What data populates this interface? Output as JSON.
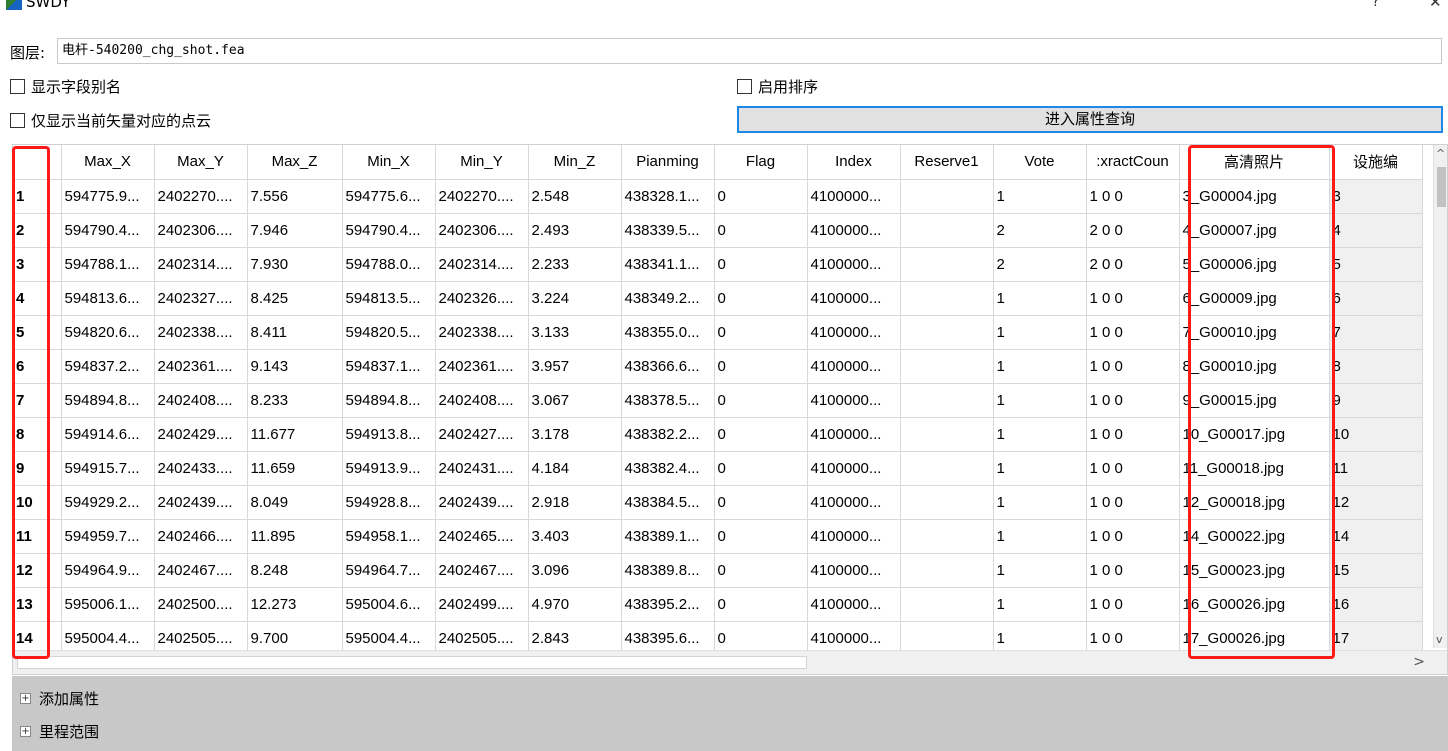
{
  "window": {
    "title": "SWDY",
    "help": "?",
    "close": "✕"
  },
  "layer": {
    "label": "图层:",
    "value": "电杆-540200_chg_shot.fea"
  },
  "options": {
    "show_alias": "显示字段别名",
    "enable_sort": "启用排序",
    "only_current_vector": "仅显示当前矢量对应的点云",
    "query_button": "进入属性查询"
  },
  "table": {
    "columns": [
      "",
      "Max_X",
      "Max_Y",
      "Max_Z",
      "Min_X",
      "Min_Y",
      "Min_Z",
      "Pianming",
      "Flag",
      "Index",
      "Reserve1",
      "Vote",
      ":xractCoun",
      "高清照片",
      "设施编"
    ],
    "rows": [
      [
        "1",
        "594775.9...",
        "2402270....",
        "7.556",
        "594775.6...",
        "2402270....",
        "2.548",
        "438328.1...",
        "0",
        "4100000...",
        "",
        "1",
        "1 0 0",
        "3_G00004.jpg",
        "3"
      ],
      [
        "2",
        "594790.4...",
        "2402306....",
        "7.946",
        "594790.4...",
        "2402306....",
        "2.493",
        "438339.5...",
        "0",
        "4100000...",
        "",
        "2",
        "2 0 0",
        "4_G00007.jpg",
        "4"
      ],
      [
        "3",
        "594788.1...",
        "2402314....",
        "7.930",
        "594788.0...",
        "2402314....",
        "2.233",
        "438341.1...",
        "0",
        "4100000...",
        "",
        "2",
        "2 0 0",
        "5_G00006.jpg",
        "5"
      ],
      [
        "4",
        "594813.6...",
        "2402327....",
        "8.425",
        "594813.5...",
        "2402326....",
        "3.224",
        "438349.2...",
        "0",
        "4100000...",
        "",
        "1",
        "1 0 0",
        "6_G00009.jpg",
        "6"
      ],
      [
        "5",
        "594820.6...",
        "2402338....",
        "8.411",
        "594820.5...",
        "2402338....",
        "3.133",
        "438355.0...",
        "0",
        "4100000...",
        "",
        "1",
        "1 0 0",
        "7_G00010.jpg",
        "7"
      ],
      [
        "6",
        "594837.2...",
        "2402361....",
        "9.143",
        "594837.1...",
        "2402361....",
        "3.957",
        "438366.6...",
        "0",
        "4100000...",
        "",
        "1",
        "1 0 0",
        "8_G00010.jpg",
        "8"
      ],
      [
        "7",
        "594894.8...",
        "2402408....",
        "8.233",
        "594894.8...",
        "2402408....",
        "3.067",
        "438378.5...",
        "0",
        "4100000...",
        "",
        "1",
        "1 0 0",
        "9_G00015.jpg",
        "9"
      ],
      [
        "8",
        "594914.6...",
        "2402429....",
        "11.677",
        "594913.8...",
        "2402427....",
        "3.178",
        "438382.2...",
        "0",
        "4100000...",
        "",
        "1",
        "1 0 0",
        "10_G00017.jpg",
        "10"
      ],
      [
        "9",
        "594915.7...",
        "2402433....",
        "11.659",
        "594913.9...",
        "2402431....",
        "4.184",
        "438382.4...",
        "0",
        "4100000...",
        "",
        "1",
        "1 0 0",
        "11_G00018.jpg",
        "11"
      ],
      [
        "10",
        "594929.2...",
        "2402439....",
        "8.049",
        "594928.8...",
        "2402439....",
        "2.918",
        "438384.5...",
        "0",
        "4100000...",
        "",
        "1",
        "1 0 0",
        "12_G00018.jpg",
        "12"
      ],
      [
        "11",
        "594959.7...",
        "2402466....",
        "11.895",
        "594958.1...",
        "2402465....",
        "3.403",
        "438389.1...",
        "0",
        "4100000...",
        "",
        "1",
        "1 0 0",
        "14_G00022.jpg",
        "14"
      ],
      [
        "12",
        "594964.9...",
        "2402467....",
        "8.248",
        "594964.7...",
        "2402467....",
        "3.096",
        "438389.8...",
        "0",
        "4100000...",
        "",
        "1",
        "1 0 0",
        "15_G00023.jpg",
        "15"
      ],
      [
        "13",
        "595006.1...",
        "2402500....",
        "12.273",
        "595004.6...",
        "2402499....",
        "4.970",
        "438395.2...",
        "0",
        "4100000...",
        "",
        "1",
        "1 0 0",
        "16_G00026.jpg",
        "16"
      ],
      [
        "14",
        "595004.4...",
        "2402505....",
        "9.700",
        "595004.4...",
        "2402505....",
        "2.843",
        "438395.6...",
        "0",
        "4100000...",
        "",
        "1",
        "1 0 0",
        "17_G00026.jpg",
        "17"
      ]
    ]
  },
  "scroll": {
    "up": "^",
    "down": "v",
    "left": "<",
    "right": ">"
  },
  "tree": [
    {
      "label": "添加属性",
      "expander": "+"
    },
    {
      "label": "里程范围",
      "expander": "+"
    }
  ],
  "colors": {
    "highlight": "#ff1a1a",
    "accent": "#1e88e5",
    "panel": "#c8c8c8"
  }
}
